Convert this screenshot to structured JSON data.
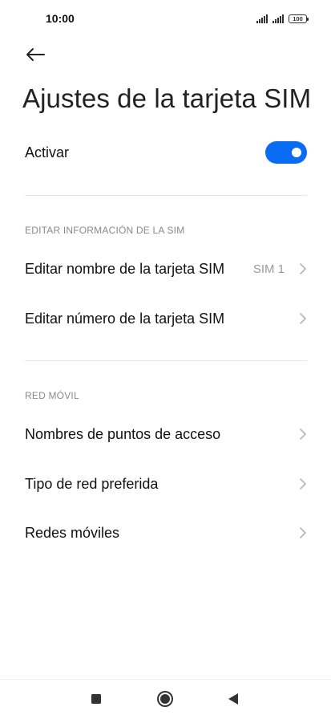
{
  "status_bar": {
    "time": "10:00",
    "battery": "100",
    "icons": [
      "signal-icon",
      "signal-icon",
      "battery-icon"
    ]
  },
  "header": {
    "back_icon": "arrow-left-icon",
    "title": "Ajustes de la tarjeta SIM"
  },
  "activate": {
    "label": "Activar",
    "enabled": true,
    "accent_color": "#0a6cf2"
  },
  "sim_info": {
    "header": "EDITAR INFORMACIÓN DE LA SIM",
    "items": [
      {
        "label": "Editar nombre de la tarjeta SIM",
        "value": "SIM 1"
      },
      {
        "label": "Editar número de la tarjeta SIM",
        "value": ""
      }
    ]
  },
  "mobile_network": {
    "header": "RED MÓVIL",
    "items": [
      {
        "label": "Nombres de puntos de acceso"
      },
      {
        "label": "Tipo de red preferida"
      },
      {
        "label": "Redes móviles"
      }
    ]
  },
  "nav_bar": {
    "icons": [
      "recents-square-icon",
      "home-circle-icon",
      "back-triangle-icon"
    ]
  }
}
